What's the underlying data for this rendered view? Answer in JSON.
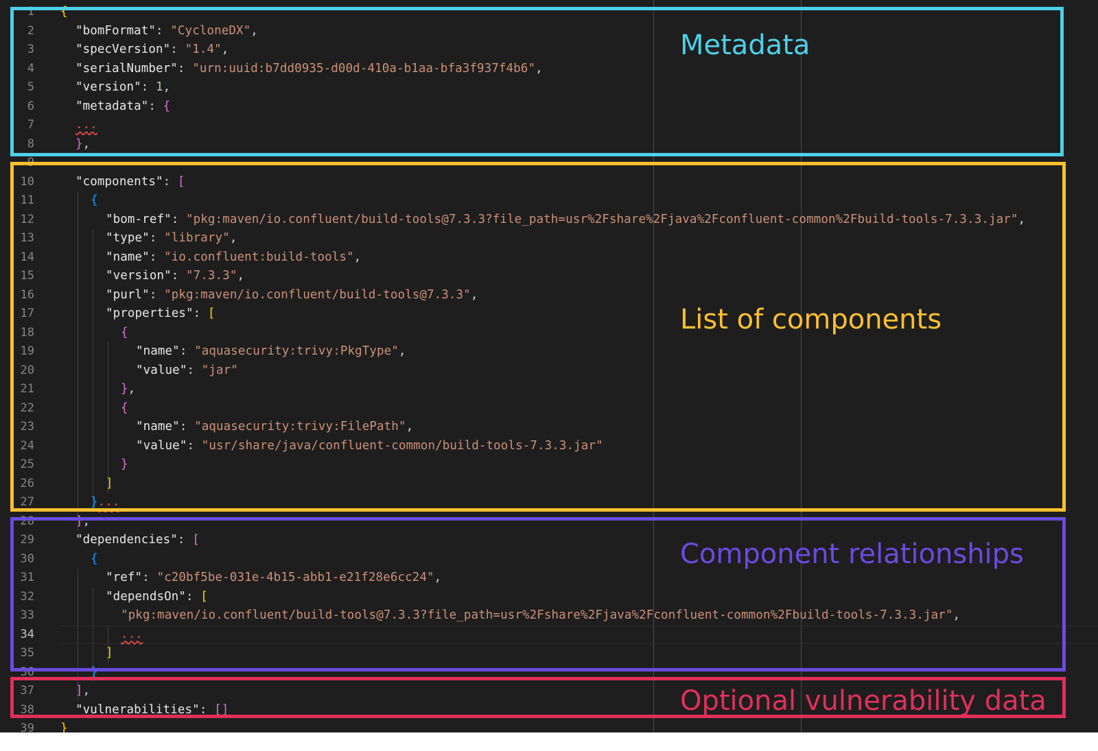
{
  "editor": {
    "lines": [
      {
        "num": "1",
        "indent": 0,
        "tokens": [
          [
            "b1",
            "{"
          ]
        ]
      },
      {
        "num": "2",
        "indent": 1,
        "tokens": [
          [
            "k",
            "\"bomFormat\""
          ],
          [
            "p",
            ": "
          ],
          [
            "s",
            "\"CycloneDX\""
          ],
          [
            "p",
            ","
          ]
        ]
      },
      {
        "num": "3",
        "indent": 1,
        "tokens": [
          [
            "k",
            "\"specVersion\""
          ],
          [
            "p",
            ": "
          ],
          [
            "s",
            "\"1.4\""
          ],
          [
            "p",
            ","
          ]
        ]
      },
      {
        "num": "4",
        "indent": 1,
        "tokens": [
          [
            "k",
            "\"serialNumber\""
          ],
          [
            "p",
            ": "
          ],
          [
            "s",
            "\"urn:uuid:b7dd0935-d00d-410a-b1aa-bfa3f937f4b6\""
          ],
          [
            "p",
            ","
          ]
        ]
      },
      {
        "num": "5",
        "indent": 1,
        "tokens": [
          [
            "k",
            "\"version\""
          ],
          [
            "p",
            ": "
          ],
          [
            "n",
            "1"
          ],
          [
            "p",
            ","
          ]
        ]
      },
      {
        "num": "6",
        "indent": 1,
        "tokens": [
          [
            "k",
            "\"metadata\""
          ],
          [
            "p",
            ": "
          ],
          [
            "b2",
            "{"
          ]
        ]
      },
      {
        "num": "7",
        "indent": 1,
        "tokens": [
          [
            "sq",
            "..."
          ]
        ]
      },
      {
        "num": "8",
        "indent": 1,
        "tokens": [
          [
            "b2",
            "}"
          ],
          [
            "p",
            ","
          ]
        ]
      },
      {
        "num": "9",
        "indent": 1,
        "tokens": []
      },
      {
        "num": "10",
        "indent": 1,
        "tokens": [
          [
            "k",
            "\"components\""
          ],
          [
            "p",
            ": "
          ],
          [
            "b2",
            "["
          ]
        ]
      },
      {
        "num": "11",
        "indent": 2,
        "tokens": [
          [
            "b3",
            "{"
          ]
        ]
      },
      {
        "num": "12",
        "indent": 3,
        "tokens": [
          [
            "k",
            "\"bom-ref\""
          ],
          [
            "p",
            ": "
          ],
          [
            "s",
            "\"pkg:maven/io.confluent/build-tools@7.3.3?file_path=usr%2Fshare%2Fjava%2Fconfluent-common%2Fbuild-tools-7.3.3.jar\""
          ],
          [
            "p",
            ","
          ]
        ]
      },
      {
        "num": "13",
        "indent": 3,
        "tokens": [
          [
            "k",
            "\"type\""
          ],
          [
            "p",
            ": "
          ],
          [
            "s",
            "\"library\""
          ],
          [
            "p",
            ","
          ]
        ]
      },
      {
        "num": "14",
        "indent": 3,
        "tokens": [
          [
            "k",
            "\"name\""
          ],
          [
            "p",
            ": "
          ],
          [
            "s",
            "\"io.confluent:build-tools\""
          ],
          [
            "p",
            ","
          ]
        ]
      },
      {
        "num": "15",
        "indent": 3,
        "tokens": [
          [
            "k",
            "\"version\""
          ],
          [
            "p",
            ": "
          ],
          [
            "s",
            "\"7.3.3\""
          ],
          [
            "p",
            ","
          ]
        ]
      },
      {
        "num": "16",
        "indent": 3,
        "tokens": [
          [
            "k",
            "\"purl\""
          ],
          [
            "p",
            ": "
          ],
          [
            "s",
            "\"pkg:maven/io.confluent/build-tools@7.3.3\""
          ],
          [
            "p",
            ","
          ]
        ]
      },
      {
        "num": "17",
        "indent": 3,
        "tokens": [
          [
            "k",
            "\"properties\""
          ],
          [
            "p",
            ": "
          ],
          [
            "b1",
            "["
          ]
        ]
      },
      {
        "num": "18",
        "indent": 4,
        "tokens": [
          [
            "b2",
            "{"
          ]
        ]
      },
      {
        "num": "19",
        "indent": 5,
        "tokens": [
          [
            "k",
            "\"name\""
          ],
          [
            "p",
            ": "
          ],
          [
            "s",
            "\"aquasecurity:trivy:PkgType\""
          ],
          [
            "p",
            ","
          ]
        ]
      },
      {
        "num": "20",
        "indent": 5,
        "tokens": [
          [
            "k",
            "\"value\""
          ],
          [
            "p",
            ": "
          ],
          [
            "s",
            "\"jar\""
          ]
        ]
      },
      {
        "num": "21",
        "indent": 4,
        "tokens": [
          [
            "b2",
            "}"
          ],
          [
            "p",
            ","
          ]
        ]
      },
      {
        "num": "22",
        "indent": 4,
        "tokens": [
          [
            "b2",
            "{"
          ]
        ]
      },
      {
        "num": "23",
        "indent": 5,
        "tokens": [
          [
            "k",
            "\"name\""
          ],
          [
            "p",
            ": "
          ],
          [
            "s",
            "\"aquasecurity:trivy:FilePath\""
          ],
          [
            "p",
            ","
          ]
        ]
      },
      {
        "num": "24",
        "indent": 5,
        "tokens": [
          [
            "k",
            "\"value\""
          ],
          [
            "p",
            ": "
          ],
          [
            "s",
            "\"usr/share/java/confluent-common/build-tools-7.3.3.jar\""
          ]
        ]
      },
      {
        "num": "25",
        "indent": 4,
        "tokens": [
          [
            "b2",
            "}"
          ]
        ]
      },
      {
        "num": "26",
        "indent": 3,
        "tokens": [
          [
            "b1",
            "]"
          ]
        ]
      },
      {
        "num": "27",
        "indent": 2,
        "tokens": [
          [
            "b3",
            "}"
          ],
          [
            "sq",
            "..."
          ]
        ]
      },
      {
        "num": "28",
        "indent": 1,
        "tokens": [
          [
            "b2",
            "]"
          ],
          [
            "p",
            ","
          ]
        ]
      },
      {
        "num": "29",
        "indent": 1,
        "tokens": [
          [
            "k",
            "\"dependencies\""
          ],
          [
            "p",
            ": "
          ],
          [
            "b2",
            "["
          ]
        ]
      },
      {
        "num": "30",
        "indent": 2,
        "tokens": [
          [
            "b3",
            "{"
          ]
        ]
      },
      {
        "num": "31",
        "indent": 3,
        "tokens": [
          [
            "k",
            "\"ref\""
          ],
          [
            "p",
            ": "
          ],
          [
            "s",
            "\"c20bf5be-031e-4b15-abb1-e21f28e6cc24\""
          ],
          [
            "p",
            ","
          ]
        ]
      },
      {
        "num": "32",
        "indent": 3,
        "tokens": [
          [
            "k",
            "\"dependsOn\""
          ],
          [
            "p",
            ": "
          ],
          [
            "b1",
            "["
          ]
        ]
      },
      {
        "num": "33",
        "indent": 4,
        "tokens": [
          [
            "s",
            "\"pkg:maven/io.confluent/build-tools@7.3.3?file_path=usr%2Fshare%2Fjava%2Fconfluent-common%2Fbuild-tools-7.3.3.jar\""
          ],
          [
            "p",
            ","
          ]
        ]
      },
      {
        "num": "34",
        "indent": 4,
        "tokens": [
          [
            "sq",
            "..."
          ]
        ]
      },
      {
        "num": "35",
        "indent": 3,
        "tokens": [
          [
            "b1",
            "]"
          ]
        ]
      },
      {
        "num": "36",
        "indent": 2,
        "tokens": [
          [
            "b3",
            "}"
          ]
        ]
      },
      {
        "num": "37",
        "indent": 1,
        "tokens": [
          [
            "b2",
            "]"
          ],
          [
            "p",
            ","
          ]
        ]
      },
      {
        "num": "38",
        "indent": 1,
        "tokens": [
          [
            "k",
            "\"vulnerabilities\""
          ],
          [
            "p",
            ": "
          ],
          [
            "b2",
            "[]"
          ]
        ]
      },
      {
        "num": "39",
        "indent": 0,
        "tokens": [
          [
            "b1",
            "}"
          ]
        ]
      }
    ],
    "active_line": "34"
  },
  "annotations": [
    {
      "id": "metadata",
      "label": "Metadata",
      "color": "#4dd0e8"
    },
    {
      "id": "components",
      "label": "List of components",
      "color": "#fdc02f"
    },
    {
      "id": "relationships",
      "label": "Component relationships",
      "color": "#6a4be0"
    },
    {
      "id": "vulnerabilities",
      "label": "Optional vulnerability data",
      "color": "#e0305a"
    }
  ]
}
